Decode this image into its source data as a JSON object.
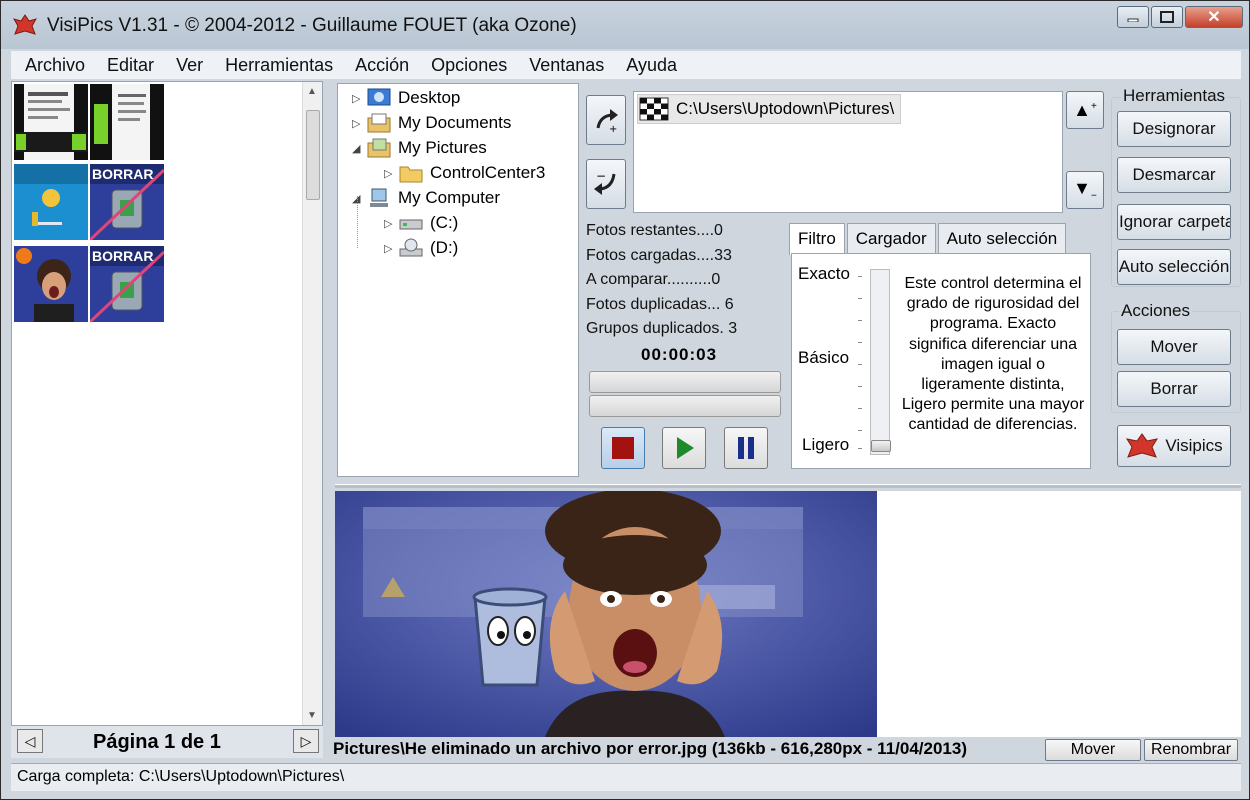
{
  "window": {
    "title": "VisiPics V1.31 - © 2004-2012 - Guillaume FOUET (aka Ozone)",
    "controls": [
      "minimize",
      "maximize",
      "close"
    ]
  },
  "menu": [
    "Archivo",
    "Editar",
    "Ver",
    "Herramientas",
    "Acción",
    "Opciones",
    "Ventanas",
    "Ayuda"
  ],
  "thumbnails": {
    "overlay_label": "BORRAR",
    "pager": "Página 1 de 1"
  },
  "tree": {
    "items": [
      {
        "label": "Desktop",
        "icon": "desktop-icon"
      },
      {
        "label": "My Documents",
        "icon": "documents-icon"
      },
      {
        "label": "My Pictures",
        "icon": "pictures-icon"
      },
      {
        "label": "ControlCenter3",
        "icon": "folder-icon"
      },
      {
        "label": "My Computer",
        "icon": "computer-icon"
      },
      {
        "label": "(C:)",
        "icon": "drive-icon"
      },
      {
        "label": "(D:)",
        "icon": "cd-drive-icon"
      }
    ]
  },
  "folder_list": {
    "path": "C:\\Users\\Uptodown\\Pictures\\"
  },
  "stats": {
    "remaining": "Fotos restantes....0",
    "loaded": "Fotos cargadas....33",
    "compare": "A comparar..........0",
    "duplicates": "Fotos duplicadas... 6",
    "groups": "Grupos duplicados. 3",
    "timer": "00:00:03"
  },
  "tabs": [
    "Filtro",
    "Cargador",
    "Auto selección"
  ],
  "filter": {
    "levels": [
      "Exacto",
      "Básico",
      "Ligero"
    ],
    "level_value": "Ligero",
    "description": "Este control determina el grado de rigurosidad del programa. Exacto significa diferenciar una imagen igual o ligeramente distinta, Ligero permite una mayor cantidad de diferencias."
  },
  "tools": {
    "group_label": "Herramientas",
    "buttons": [
      "Designorar",
      "Desmarcar",
      "Ignorar carpeta",
      "Auto selección"
    ]
  },
  "actions": {
    "group_label": "Acciones",
    "buttons": [
      "Mover",
      "Borrar"
    ],
    "visipics": "Visipics"
  },
  "preview": {
    "file_info": "Pictures\\He eliminado un archivo por error.jpg (136kb - 616,280px - 11/04/2013)",
    "move": "Mover",
    "rename": "Renombrar"
  },
  "status": "Carga completa: C:\\Users\\Uptodown\\Pictures\\"
}
